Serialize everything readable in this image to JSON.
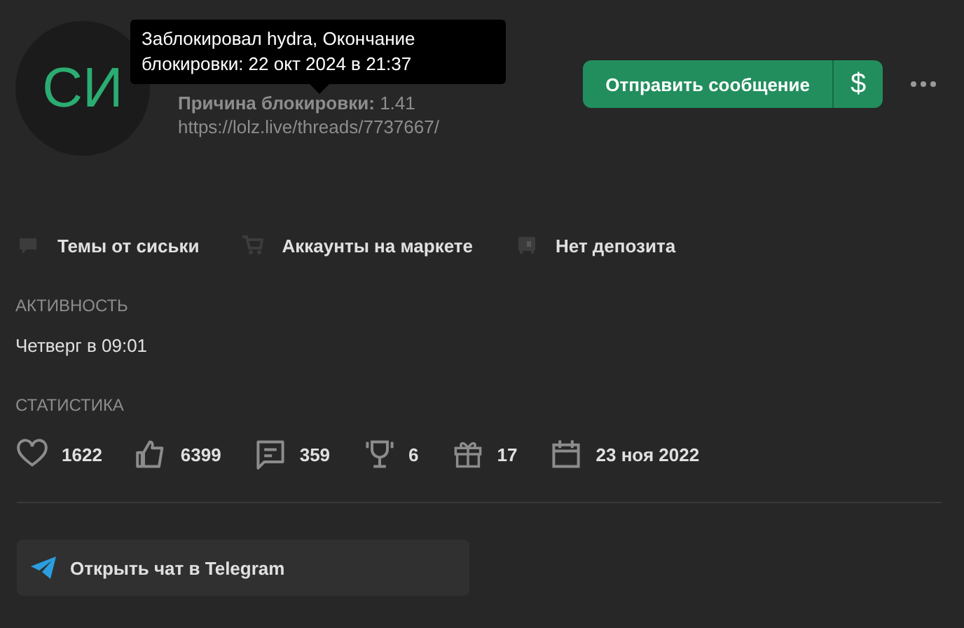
{
  "avatar": {
    "initials": "СИ"
  },
  "tooltip": {
    "text": "Заблокировал hydra, Окончание блокировки: 22 окт 2024 в 21:37"
  },
  "ban_reason": {
    "label": "Причина блокировки:",
    "value": "1.41"
  },
  "ban_link": "https://lolz.live/threads/7737667/",
  "actions": {
    "send_message": "Отправить сообщение",
    "money": "$"
  },
  "links": [
    {
      "kind": "threads",
      "label": "Темы от сиськи"
    },
    {
      "kind": "market",
      "label": "Аккаунты на маркете"
    },
    {
      "kind": "deposit",
      "label": "Нет депозита"
    }
  ],
  "activity": {
    "title": "АКТИВНОСТЬ",
    "value": "Четверг в 09:01"
  },
  "stats": {
    "title": "СТАТИСТИКА",
    "items": [
      {
        "kind": "likes",
        "value": "1622"
      },
      {
        "kind": "thumbs",
        "value": "6399"
      },
      {
        "kind": "messages",
        "value": "359"
      },
      {
        "kind": "trophies",
        "value": "6"
      },
      {
        "kind": "gifts",
        "value": "17"
      },
      {
        "kind": "registered",
        "value": "23 ноя 2022"
      }
    ]
  },
  "telegram": {
    "label": "Открыть чат в Telegram"
  }
}
